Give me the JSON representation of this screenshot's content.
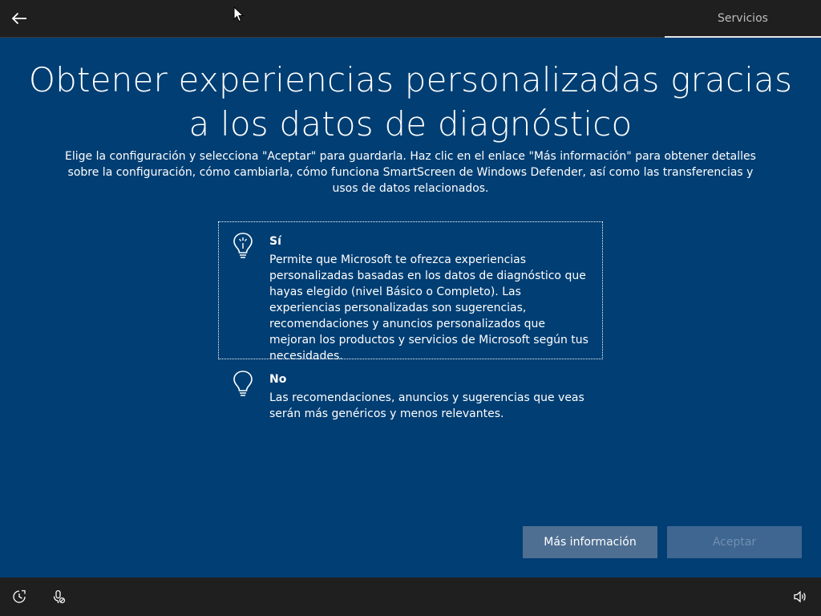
{
  "header": {
    "tab_label": "Servicios",
    "back_icon": "back-arrow-icon"
  },
  "main": {
    "title": "Obtener experiencias personalizadas gracias a los datos de diagnóstico",
    "description": "Elige la configuración y selecciona \"Aceptar\" para guardarla. Haz clic en el enlace \"Más información\" para obtener detalles sobre la configuración, cómo cambiarla, cómo funciona SmartScreen de Windows Defender, así como las transferencias y usos de datos relacionados.",
    "options": [
      {
        "title": "Sí",
        "description": "Permite que Microsoft te ofrezca experiencias personalizadas basadas en los datos de diagnóstico que hayas elegido (nivel Básico o Completo). Las experiencias personalizadas son sugerencias, recomendaciones y anuncios personalizados que mejoran los productos y servicios de Microsoft según tus necesidades.",
        "icon": "lightbulb-on-icon",
        "selected": true
      },
      {
        "title": "No",
        "description": "Las recomendaciones, anuncios y sugerencias que veas serán más genéricos y menos relevantes.",
        "icon": "lightbulb-off-icon",
        "selected": false
      }
    ]
  },
  "buttons": {
    "more_info": "Más información",
    "accept": "Aceptar"
  },
  "footer": {
    "icons": [
      "ease-of-access-icon",
      "microphone-off-icon",
      "volume-icon"
    ]
  },
  "colors": {
    "background": "#003e73",
    "bar": "#1f1f1f",
    "button": "#4e6f92",
    "button_disabled": "#3e6690"
  }
}
